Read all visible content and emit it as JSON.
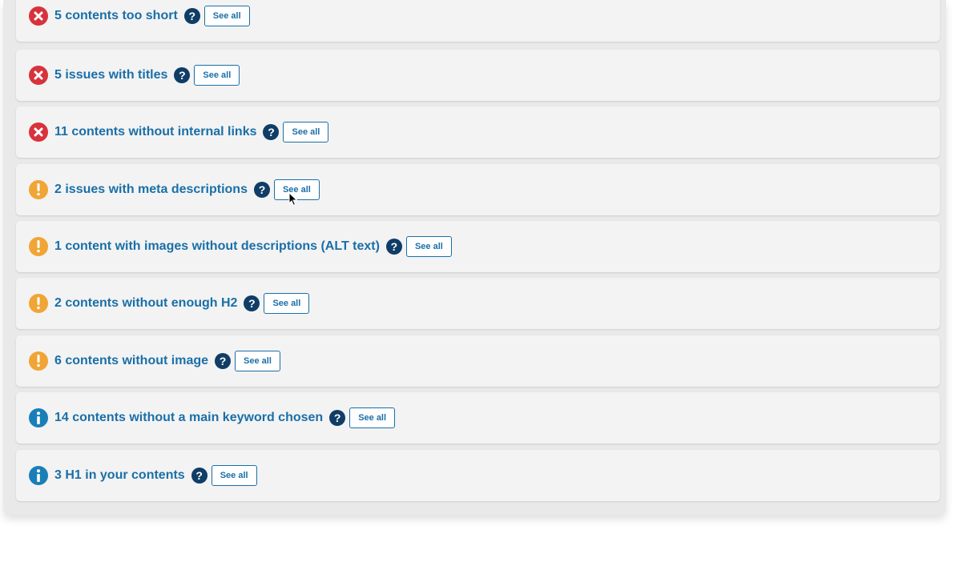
{
  "see_all_label": "See all",
  "help_glyph": "?",
  "colors": {
    "error": "#d8323c",
    "warning": "#f0a535",
    "info": "#1a7fb8",
    "link": "#1a6fa8",
    "help": "#0f3d66"
  },
  "issues": [
    {
      "severity": "error",
      "icon": "x-circle-icon",
      "label": "5 contents too short"
    },
    {
      "severity": "error",
      "icon": "x-circle-icon",
      "label": "5 issues with titles"
    },
    {
      "severity": "error",
      "icon": "x-circle-icon",
      "label": "11 contents without internal links"
    },
    {
      "severity": "warning",
      "icon": "exclamation-circle-icon",
      "label": "2 issues with meta descriptions"
    },
    {
      "severity": "warning",
      "icon": "exclamation-circle-icon",
      "label": "1 content with images without descriptions (ALT text)"
    },
    {
      "severity": "warning",
      "icon": "exclamation-circle-icon",
      "label": "2 contents without enough H2"
    },
    {
      "severity": "warning",
      "icon": "exclamation-circle-icon",
      "label": "6 contents without image"
    },
    {
      "severity": "info",
      "icon": "info-circle-icon",
      "label": "14 contents without a main keyword chosen"
    },
    {
      "severity": "info",
      "icon": "info-circle-icon",
      "label": "3 H1 in your contents"
    }
  ]
}
